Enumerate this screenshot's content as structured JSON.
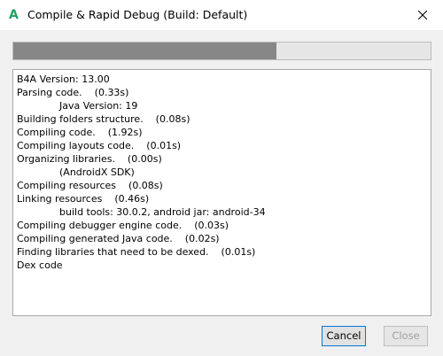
{
  "window": {
    "title": "Compile & Rapid Debug (Build: Default)",
    "app_icon_glyph": "A",
    "icons": [
      "b4a-app-icon",
      "close-icon"
    ]
  },
  "progress": {
    "fraction": 0.63
  },
  "log": {
    "lines": [
      {
        "text": "B4A Version: 13.00",
        "indent": false
      },
      {
        "text": "Parsing code.    (0.33s)",
        "indent": false
      },
      {
        "text": "Java Version: 19",
        "indent": true
      },
      {
        "text": "Building folders structure.    (0.08s)",
        "indent": false
      },
      {
        "text": "Compiling code.    (1.92s)",
        "indent": false
      },
      {
        "text": "Compiling layouts code.    (0.01s)",
        "indent": false
      },
      {
        "text": "Organizing libraries.    (0.00s)",
        "indent": false
      },
      {
        "text": "(AndroidX SDK)",
        "indent": true
      },
      {
        "text": "Compiling resources    (0.08s)",
        "indent": false
      },
      {
        "text": "Linking resources    (0.46s)",
        "indent": false
      },
      {
        "text": "build tools: 30.0.2, android jar: android-34",
        "indent": true
      },
      {
        "text": "Compiling debugger engine code.    (0.03s)",
        "indent": false
      },
      {
        "text": "Compiling generated Java code.    (0.02s)",
        "indent": false
      },
      {
        "text": "Finding libraries that need to be dexed.    (0.01s)",
        "indent": false
      },
      {
        "text": "Dex code",
        "indent": false
      }
    ]
  },
  "buttons": {
    "cancel_label": "Cancel",
    "close_label": "Close",
    "close_enabled": false
  },
  "colors": {
    "accent": "#0078d7",
    "app_icon": "#1fa463",
    "progress_fill": "#878787"
  }
}
